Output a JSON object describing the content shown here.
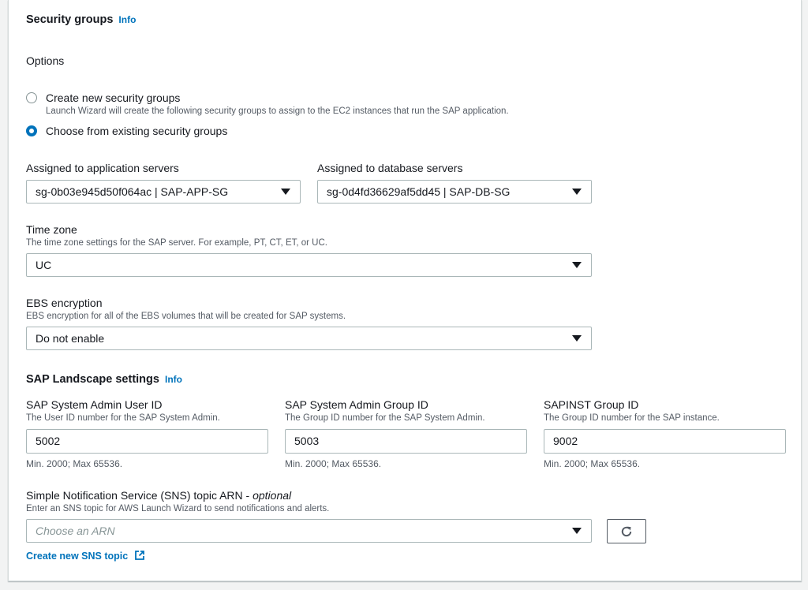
{
  "security_groups": {
    "title": "Security groups",
    "info": "Info",
    "options_label": "Options",
    "options": [
      {
        "label": "Create new security groups",
        "description": "Launch Wizard will create the following security groups to assign to the EC2 instances that run the SAP application.",
        "checked": false
      },
      {
        "label": "Choose from existing security groups",
        "description": "",
        "checked": true
      }
    ],
    "app_servers": {
      "label": "Assigned to application servers",
      "value": "sg-0b03e945d50f064ac | SAP-APP-SG"
    },
    "db_servers": {
      "label": "Assigned to database servers",
      "value": "sg-0d4fd36629af5dd45 | SAP-DB-SG"
    }
  },
  "time_zone": {
    "label": "Time zone",
    "description": "The time zone settings for the SAP server. For example, PT, CT, ET, or UC.",
    "value": "UC"
  },
  "ebs": {
    "label": "EBS encryption",
    "description": "EBS encryption for all of the EBS volumes that will be created for SAP systems.",
    "value": "Do not enable"
  },
  "landscape": {
    "title": "SAP Landscape settings",
    "info": "Info",
    "fields": [
      {
        "label": "SAP System Admin User ID",
        "description": "The User ID number for the SAP System Admin.",
        "value": "5002",
        "hint": "Min. 2000; Max 65536."
      },
      {
        "label": "SAP System Admin Group ID",
        "description": "The Group ID number for the SAP System Admin.",
        "value": "5003",
        "hint": "Min. 2000; Max 65536."
      },
      {
        "label": "SAPINST Group ID",
        "description": "The Group ID number for the SAP instance.",
        "value": "9002",
        "hint": "Min. 2000; Max 65536."
      }
    ]
  },
  "sns": {
    "label": "Simple Notification Service (SNS) topic ARN - ",
    "label_optional": "optional",
    "description": "Enter an SNS topic for AWS Launch Wizard to send notifications and alerts.",
    "placeholder": "Choose an ARN",
    "create_link": "Create new SNS topic"
  },
  "colors": {
    "accent": "#0073bb",
    "text": "#16191f",
    "muted": "#545b64"
  }
}
